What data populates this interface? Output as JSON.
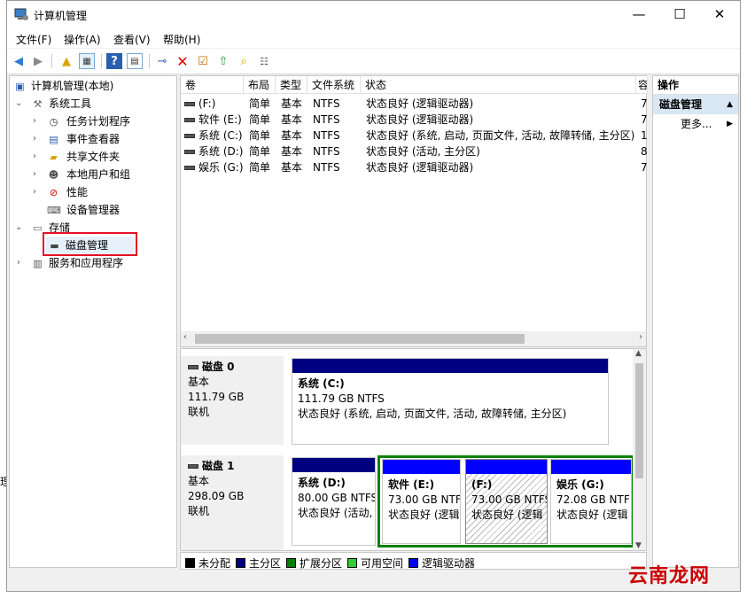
{
  "window": {
    "title": "计算机管理",
    "min": "—",
    "max": "☐",
    "close": "✕"
  },
  "menu": [
    "文件(F)",
    "操作(A)",
    "查看(V)",
    "帮助(H)"
  ],
  "tree": {
    "root": "计算机管理(本地)",
    "system_tools": "系统工具",
    "task_scheduler": "任务计划程序",
    "event_viewer": "事件查看器",
    "shared_folders": "共享文件夹",
    "local_users": "本地用户和组",
    "performance": "性能",
    "device_manager": "设备管理器",
    "storage": "存储",
    "disk_management": "磁盘管理",
    "services_apps": "服务和应用程序"
  },
  "volumes": {
    "headers": [
      "卷",
      "布局",
      "类型",
      "文件系统",
      "状态",
      "容"
    ],
    "rows": [
      {
        "vol": "(F:)",
        "layout": "简单",
        "type": "基本",
        "fs": "NTFS",
        "status": "状态良好 (逻辑驱动器)",
        "cap": "7"
      },
      {
        "vol": "软件 (E:)",
        "layout": "简单",
        "type": "基本",
        "fs": "NTFS",
        "status": "状态良好 (逻辑驱动器)",
        "cap": "7"
      },
      {
        "vol": "系统 (C:)",
        "layout": "简单",
        "type": "基本",
        "fs": "NTFS",
        "status": "状态良好 (系统, 启动, 页面文件, 活动, 故障转储, 主分区)",
        "cap": "1"
      },
      {
        "vol": "系统 (D:)",
        "layout": "简单",
        "type": "基本",
        "fs": "NTFS",
        "status": "状态良好 (活动, 主分区)",
        "cap": "8"
      },
      {
        "vol": "娱乐 (G:)",
        "layout": "简单",
        "type": "基本",
        "fs": "NTFS",
        "status": "状态良好 (逻辑驱动器)",
        "cap": "7"
      }
    ]
  },
  "disks": [
    {
      "name": "磁盘 0",
      "kind": "基本",
      "size": "111.79 GB",
      "state": "联机",
      "partitions": [
        {
          "title": "系统  (C:)",
          "size": "111.79 GB NTFS",
          "status": "状态良好 (系统, 启动, 页面文件, 活动, 故障转储, 主分区)"
        }
      ]
    },
    {
      "name": "磁盘 1",
      "kind": "基本",
      "size": "298.09 GB",
      "state": "联机",
      "partitions": [
        {
          "title": "系统  (D:)",
          "size": "80.00 GB NTFS",
          "status": "状态良好 (活动,"
        },
        {
          "title": "软件  (E:)",
          "size": "73.00 GB NTF",
          "status": "状态良好 (逻辑"
        },
        {
          "title": "(F:)",
          "size": "73.00 GB NTFS",
          "status": "状态良好 (逻辑"
        },
        {
          "title": "娱乐  (G:)",
          "size": "72.08 GB NTF",
          "status": "状态良好 (逻辑"
        }
      ]
    }
  ],
  "legend": [
    {
      "label": "未分配",
      "color": "#000000"
    },
    {
      "label": "主分区",
      "color": "#000080"
    },
    {
      "label": "扩展分区",
      "color": "#008000"
    },
    {
      "label": "可用空间",
      "color": "#33cc33"
    },
    {
      "label": "逻辑驱动器",
      "color": "#0000ff"
    }
  ],
  "actions": {
    "header": "操作",
    "selected": "磁盘管理",
    "more": "更多..."
  },
  "watermark": "云南龙网",
  "fragment": "理"
}
